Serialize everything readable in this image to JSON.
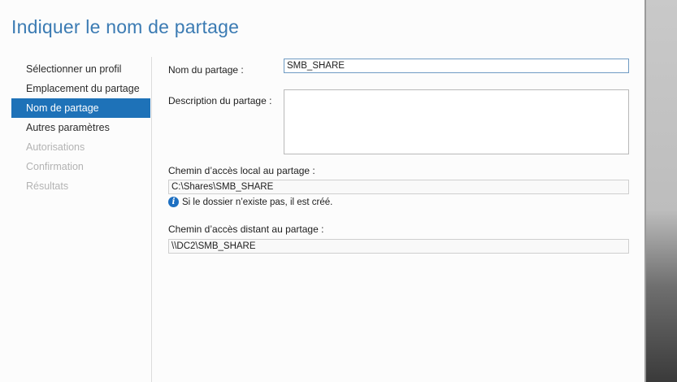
{
  "title": "Indiquer le nom de partage",
  "nav": {
    "items": [
      {
        "label": "Sélectionner un profil",
        "state": "normal"
      },
      {
        "label": "Emplacement du partage",
        "state": "normal"
      },
      {
        "label": "Nom de partage",
        "state": "active"
      },
      {
        "label": "Autres paramètres",
        "state": "normal"
      },
      {
        "label": "Autorisations",
        "state": "disabled"
      },
      {
        "label": "Confirmation",
        "state": "disabled"
      },
      {
        "label": "Résultats",
        "state": "disabled"
      }
    ]
  },
  "form": {
    "share_name_label": "Nom du partage :",
    "share_name_value": "SMB_SHARE",
    "description_label": "Description du partage :",
    "description_value": "",
    "local_path_label": "Chemin d’accès local au partage :",
    "local_path_value": "C:\\Shares\\SMB_SHARE",
    "info_text": "Si le dossier n’existe pas, il est créé.",
    "remote_path_label": "Chemin d’accès distant au partage :",
    "remote_path_value": "\\\\DC2\\SMB_SHARE"
  },
  "colors": {
    "accent": "#1e72b8",
    "title": "#3b7bb3",
    "disabled_text": "#b3b3b3"
  },
  "icons": {
    "info": "info-icon"
  }
}
